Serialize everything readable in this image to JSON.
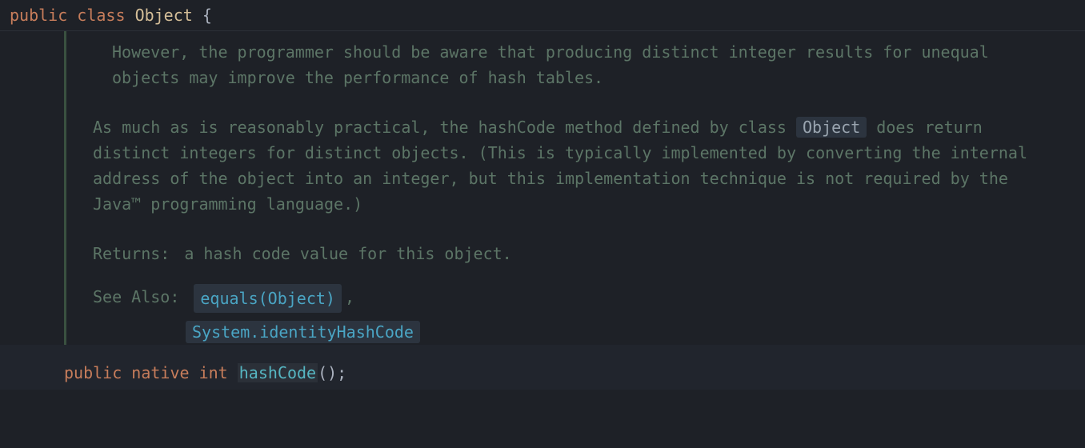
{
  "header": {
    "public": "public",
    "class": "class",
    "name": "Object",
    "brace": "{"
  },
  "doc": {
    "para1": "However, the programmer should be aware that producing distinct integer results for unequal objects may improve the performance of hash tables.",
    "para2_before": "As much as is reasonably practical, the hashCode method defined by class ",
    "para2_code": "Object",
    "para2_after": " does return distinct integers for distinct objects. (This is typically implemented by converting the internal address of the object into an integer, but this implementation technique is not required by the Java™ programming language.)",
    "returns_label": "Returns:",
    "returns_value": "a hash code value for this object.",
    "seealso_label": "See Also:",
    "seealso_link1": "equals(Object)",
    "seealso_sep": ",",
    "seealso_link2": "System.identityHashCode"
  },
  "code": {
    "public": "public",
    "native": "native",
    "int": "int",
    "method": "hashCode",
    "tail": "();"
  }
}
